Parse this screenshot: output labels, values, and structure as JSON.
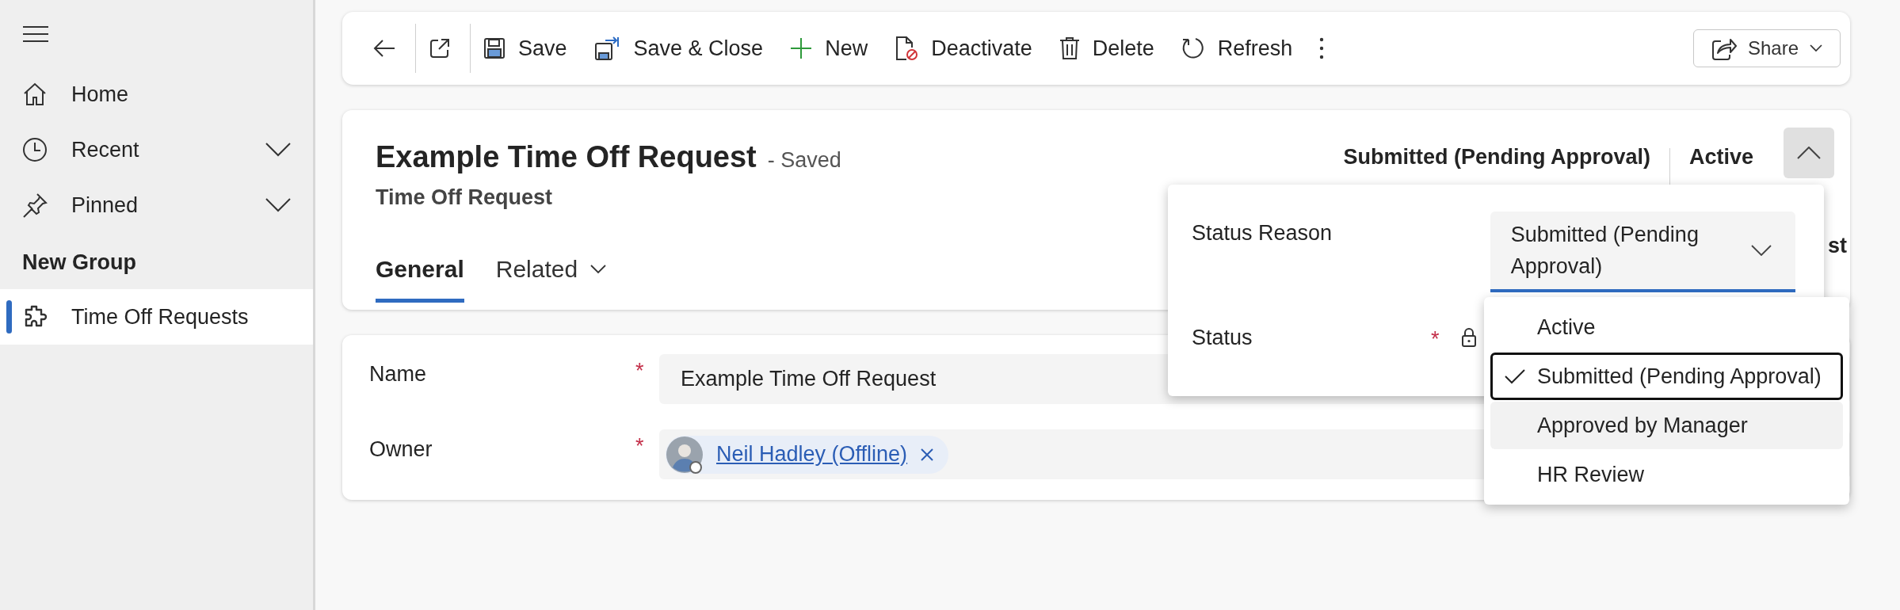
{
  "sidebar": {
    "items": [
      {
        "label": "Home",
        "kind": "home",
        "expandable": false
      },
      {
        "label": "Recent",
        "kind": "clock",
        "expandable": true
      },
      {
        "label": "Pinned",
        "kind": "pin",
        "expandable": true
      }
    ],
    "group_title": "New Group",
    "group_items": [
      {
        "label": "Time Off Requests",
        "kind": "puzzle",
        "selected": true
      }
    ]
  },
  "toolbar": {
    "buttons": [
      {
        "kind": "back"
      },
      {
        "kind": "popout"
      },
      {
        "kind": "save",
        "label": "Save"
      },
      {
        "kind": "save-close",
        "label": "Save & Close"
      },
      {
        "kind": "new",
        "label": "New"
      },
      {
        "kind": "deactivate",
        "label": "Deactivate"
      },
      {
        "kind": "delete",
        "label": "Delete"
      },
      {
        "kind": "refresh",
        "label": "Refresh"
      },
      {
        "kind": "more"
      }
    ],
    "share": {
      "label": "Share"
    }
  },
  "record": {
    "title": "Example Time Off Request",
    "save_state": "- Saved",
    "entity": "Time Off Request",
    "status_reason": "Submitted (Pending Approval)",
    "status": "Active",
    "expanded": true,
    "hidden_tab_tail": "st"
  },
  "tabs": [
    {
      "label": "General",
      "selected": true,
      "has_menu": false
    },
    {
      "label": "Related",
      "selected": false,
      "has_menu": true
    }
  ],
  "fields": [
    {
      "label": "Name",
      "required_mark": "*",
      "kind": "text",
      "value": "Example Time Off Request"
    },
    {
      "label": "Owner",
      "required_mark": "*",
      "kind": "lookup",
      "value": "Neil Hadley (Offline)"
    }
  ],
  "flyout": {
    "fields": [
      {
        "label": "Status Reason",
        "kind": "select",
        "locked": false,
        "value": "Submitted (Pending Approval)"
      },
      {
        "label": "Status",
        "kind": "locked",
        "required_mark": "*",
        "locked": true
      }
    ],
    "options": [
      {
        "label": "Active",
        "selected": false,
        "hovered": false
      },
      {
        "label": "Submitted (Pending Approval)",
        "selected": true,
        "hovered": false
      },
      {
        "label": "Approved by Manager",
        "selected": false,
        "hovered": true
      },
      {
        "label": "HR Review",
        "selected": false,
        "hovered": false
      }
    ]
  }
}
